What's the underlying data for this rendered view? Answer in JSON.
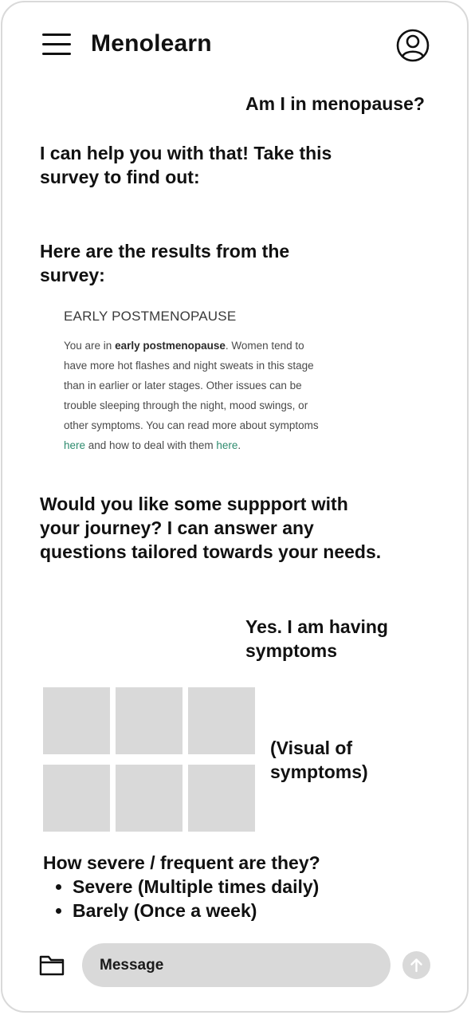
{
  "header": {
    "title": "Menolearn",
    "menu_icon": "hamburger-menu-icon",
    "profile_icon": "user-profile-icon"
  },
  "chat": {
    "user_message_1": "Am I in menopause?",
    "bot_message_1": "I can help you with that! Take this survey to find out:",
    "bot_message_2": "Here are the results from the survey:",
    "result": {
      "title": "EARLY POSTMENOPAUSE",
      "body_prefix": "You are in ",
      "body_bold": "early postmenopause",
      "body_middle": ". Women tend to have more hot flashes and night sweats in this stage than in earlier or later stages. Other issues can be trouble sleeping through the night, mood swings, or other symptoms. You can read more about symptoms ",
      "link_1": "here",
      "body_and": " and how to deal with them ",
      "link_2": "here",
      "body_end": "."
    },
    "bot_message_3": "Would you like some suppport with your journey? I can answer any questions tailored towards your needs.",
    "user_message_2": "Yes. I am having symptoms",
    "visual_label": "(Visual of symptoms)",
    "question": "How severe / frequent are they?",
    "options": [
      "Severe (Multiple times daily)",
      "Barely (Once a week)"
    ]
  },
  "composer": {
    "placeholder": "Message",
    "attach_icon": "folder-icon",
    "send_icon": "arrow-up-icon"
  },
  "colors": {
    "link": "#2e8b6e",
    "placeholder_tile": "#d9d9d9",
    "input_background": "#d9d9d9"
  }
}
